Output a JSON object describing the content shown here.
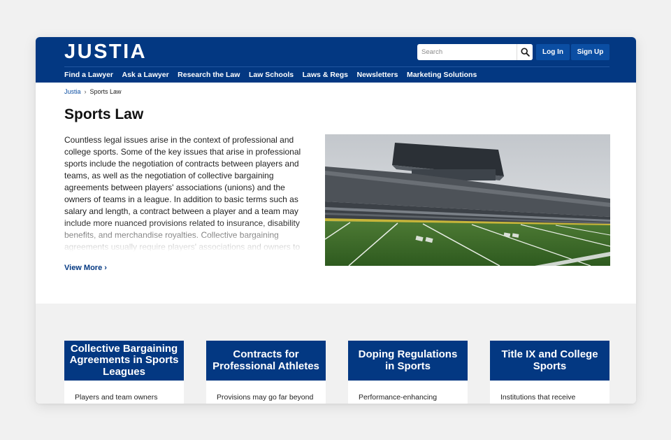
{
  "header": {
    "logo": "JUSTIA",
    "search_placeholder": "Search",
    "login_label": "Log In",
    "signup_label": "Sign Up",
    "nav": [
      "Find a Lawyer",
      "Ask a Lawyer",
      "Research the Law",
      "Law Schools",
      "Laws & Regs",
      "Newsletters",
      "Marketing Solutions"
    ]
  },
  "breadcrumb": {
    "home": "Justia",
    "separator": "›",
    "current": "Sports Law"
  },
  "page": {
    "title": "Sports Law",
    "intro": "Countless legal issues arise in the context of professional and college sports. Some of the key issues that arise in professional sports include the negotiation of contracts between players and teams, as well as the negotiation of collective bargaining agreements between players' associations (unions) and the owners of teams in a league. In addition to basic terms such as salary and length, a contract between a player and a team may include more nuanced provisions related to insurance, disability benefits, and merchandise royalties. Collective bargaining agreements usually require players' associations and owners to",
    "view_more": "View More ›"
  },
  "cards": [
    {
      "title": "Collective Bargaining Agreements in Sports Leagues",
      "snippet": "Players and team owners"
    },
    {
      "title": "Contracts for Professional Athletes",
      "snippet": "Provisions may go far beyond"
    },
    {
      "title": "Doping Regulations in Sports",
      "snippet": "Performance-enhancing"
    },
    {
      "title": "Title IX and College Sports",
      "snippet": "Institutions that receive"
    }
  ],
  "colors": {
    "brand_navy": "#033882",
    "button_blue": "#0b4ea3",
    "band_gray": "#f1f1f1"
  },
  "icons": {
    "search": "magnifier-icon",
    "breadcrumb_separator": "chevron-right"
  }
}
